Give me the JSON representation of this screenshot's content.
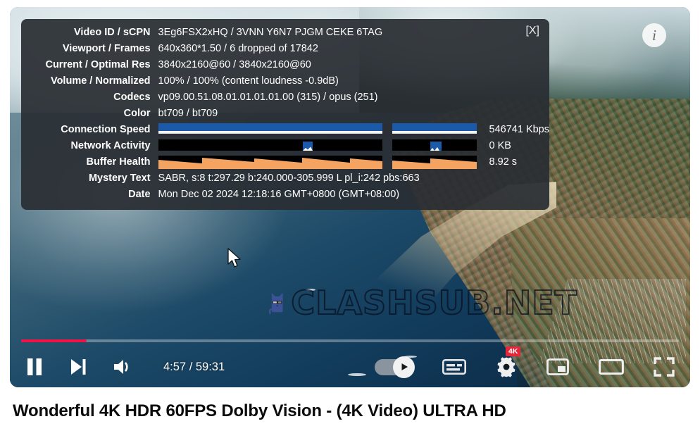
{
  "player": {
    "close_label": "[X]",
    "info_icon": "info-circle-icon",
    "watermark_text": "CLASHSUB.NET",
    "watermark_mascot": "blue-cat-sunglasses-icon"
  },
  "stats": {
    "rows": [
      {
        "label": "Video ID / sCPN",
        "value": "3Eg6FSX2xHQ  /  3VNN Y6N7 PJGM CEKE 6TAG"
      },
      {
        "label": "Viewport / Frames",
        "value": "640x360*1.50 / 6 dropped of 17842"
      },
      {
        "label": "Current / Optimal Res",
        "value": "3840x2160@60 / 3840x2160@60"
      },
      {
        "label": "Volume / Normalized",
        "value": "100% / 100% (content loudness -0.9dB)"
      },
      {
        "label": "Codecs",
        "value": "vp09.00.51.08.01.01.01.01.00 (315) / opus (251)"
      },
      {
        "label": "Color",
        "value": "bt709 / bt709"
      }
    ],
    "graph_rows": [
      {
        "label": "Connection Speed",
        "unit": "546741 Kbps",
        "graph": "connection-speed-graph"
      },
      {
        "label": "Network Activity",
        "unit": "0 KB",
        "graph": "network-activity-graph"
      },
      {
        "label": "Buffer Health",
        "unit": "8.92 s",
        "graph": "buffer-health-graph"
      }
    ],
    "tail_rows": [
      {
        "label": "Mystery Text",
        "value": "SABR, s:8 t:297.29 b:240.000-305.999 L pl_i:242 pbs:663"
      },
      {
        "label": "Date",
        "value": "Mon Dec 02 2024 12:18:16 GMT+0800 (GMT+08:00)"
      }
    ],
    "colors": {
      "connection_bar": "#1a5aa8",
      "connection_line": "#ffffff",
      "network_bar": "#1a5aa8",
      "network_bg": "#000000",
      "buffer_fill": "#f4a460"
    }
  },
  "controls": {
    "pause_label": "pause-button",
    "next_label": "next-video-button",
    "volume_label": "volume-button",
    "time": "4:57 / 59:31",
    "autoplay_label": "autoplay-toggle",
    "captions_label": "subtitles-button",
    "settings_label": "settings-button",
    "settings_badge": "4K",
    "miniplayer_label": "miniplayer-button",
    "theater_label": "theater-mode-button",
    "fullscreen_label": "fullscreen-button",
    "progress_percent": 10,
    "progress_color": "#f01446"
  },
  "title": "Wonderful 4K HDR 60FPS Dolby Vision - (4K Video) ULTRA HD"
}
